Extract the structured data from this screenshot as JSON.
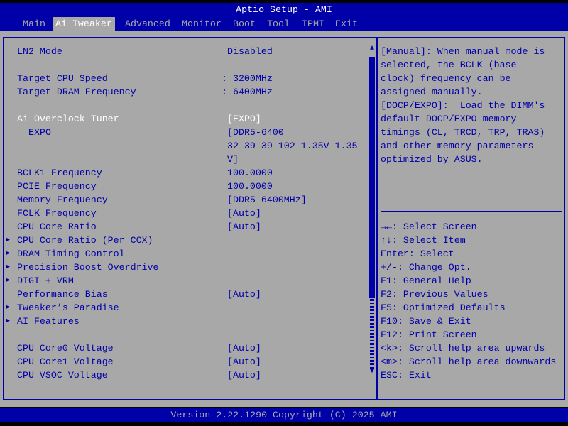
{
  "title": "Aptio Setup - AMI",
  "tabs": [
    "Main",
    "Ai Tweaker",
    "Advanced",
    "Monitor",
    "Boot",
    "Tool",
    "IPMI",
    "Exit"
  ],
  "active_tab": "Ai Tweaker",
  "items": [
    {
      "label": "LN2 Mode",
      "value": "Disabled"
    },
    {
      "label": "Target CPU Speed",
      "value": ": 3200MHz"
    },
    {
      "label": "Target DRAM Frequency",
      "value": ": 6400MHz"
    },
    {
      "label": "Ai Overclock Tuner",
      "value": "[EXPO]",
      "selected": true
    },
    {
      "label": "EXPO",
      "value": "[DDR5-6400",
      "value2": "32-39-39-102-1.35V-1.35",
      "value3": "V]"
    },
    {
      "label": "BCLK1 Frequency",
      "value": "100.0000"
    },
    {
      "label": "PCIE Frequency",
      "value": "100.0000"
    },
    {
      "label": "Memory Frequency",
      "value": "[DDR5-6400MHz]"
    },
    {
      "label": "FCLK Frequency",
      "value": "[Auto]"
    },
    {
      "label": "CPU Core Ratio",
      "value": "[Auto]"
    },
    {
      "label": "CPU Core Ratio (Per CCX)",
      "submenu": true
    },
    {
      "label": "DRAM Timing Control",
      "submenu": true
    },
    {
      "label": "Precision Boost Overdrive",
      "submenu": true
    },
    {
      "label": "DIGI + VRM",
      "submenu": true
    },
    {
      "label": "Performance Bias",
      "value": "[Auto]"
    },
    {
      "label": "Tweaker’s Paradise",
      "submenu": true
    },
    {
      "label": "AI Features",
      "submenu": true
    },
    {
      "label": "CPU Core0 Voltage",
      "value": "[Auto]"
    },
    {
      "label": "CPU Core1 Voltage",
      "value": "[Auto]"
    },
    {
      "label": "CPU VSOC Voltage",
      "value": "[Auto]"
    }
  ],
  "help_text": [
    "[Manual]: When manual mode is",
    "selected, the BCLK (base",
    "clock) frequency can be",
    "assigned manually.",
    "[DOCP/EXPO]:  Load the DIMM's",
    "default DOCP/EXPO memory",
    "timings (CL, TRCD, TRP, TRAS)",
    "and other memory parameters",
    "optimized by ASUS."
  ],
  "keys": [
    "→←: Select Screen",
    "↑↓: Select Item",
    "Enter: Select",
    "+/-: Change Opt.",
    "F1: General Help",
    "F2: Previous Values",
    "F5: Optimized Defaults",
    "F10: Save & Exit",
    "F12: Print Screen",
    "<k>: Scroll help area upwards",
    "<m>: Scroll help area downwards",
    "ESC: Exit"
  ],
  "footer": "Version 2.22.1290 Copyright (C) 2025 AMI",
  "colors": {
    "blue": "#0000a8",
    "gray": "#a8a8a8",
    "selected": "#ffffff"
  }
}
